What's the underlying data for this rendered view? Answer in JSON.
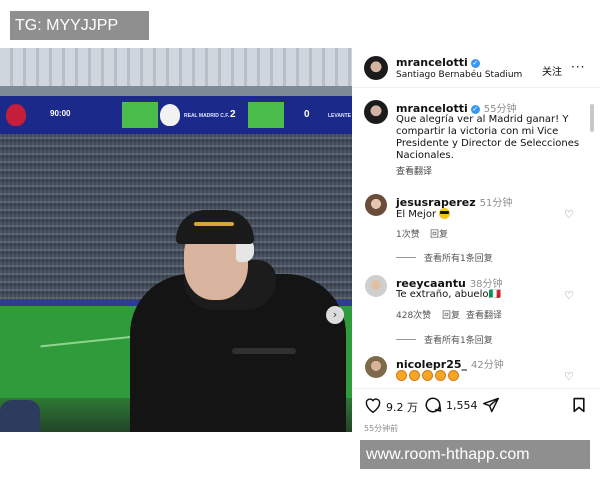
{
  "watermarks": {
    "top": "TG: MYYJJPP",
    "bottom": "www.room-hthapp.com"
  },
  "scoreboard": {
    "time": "90:00",
    "home_team": "REAL MADRID C.F.",
    "home_score": "2",
    "away_team": "LEVANTE",
    "away_score": "0"
  },
  "post": {
    "author": "mrancelotti",
    "location": "Santiago Bernabéu Stadium",
    "follow_label": "关注",
    "more_icon": "more-horizontal-icon",
    "caption_time": "55分钟",
    "caption": "Que alegría ver al Madrid ganar! Y compartir la victoria con mi Vice Presidente y Director de Selecciones Nacionales.",
    "translate_label": "查看翻译"
  },
  "comments": [
    {
      "user": "jesusraperez",
      "time": "51分钟",
      "text": "El Mejor",
      "likes": "1次赞",
      "reply": "回复",
      "replies": "查看所有1条回复"
    },
    {
      "user": "reeycaantu",
      "time": "38分钟",
      "text": "Te extraño, abuelo🇮🇹",
      "likes": "428次赞",
      "reply": "回复",
      "translate": "查看翻译",
      "replies": "查看所有1条回复"
    },
    {
      "user": "nicolepr25_",
      "time": "42分钟",
      "text": "🤩🤩🤩🤩🤩"
    }
  ],
  "actions": {
    "likes": "9.2 万",
    "comments": "1,554",
    "ago": "55分钟前"
  },
  "colors": {
    "verified": "#3897f0",
    "pitch": "#2f9b3b",
    "scoreboard": "#1b2a8a"
  }
}
